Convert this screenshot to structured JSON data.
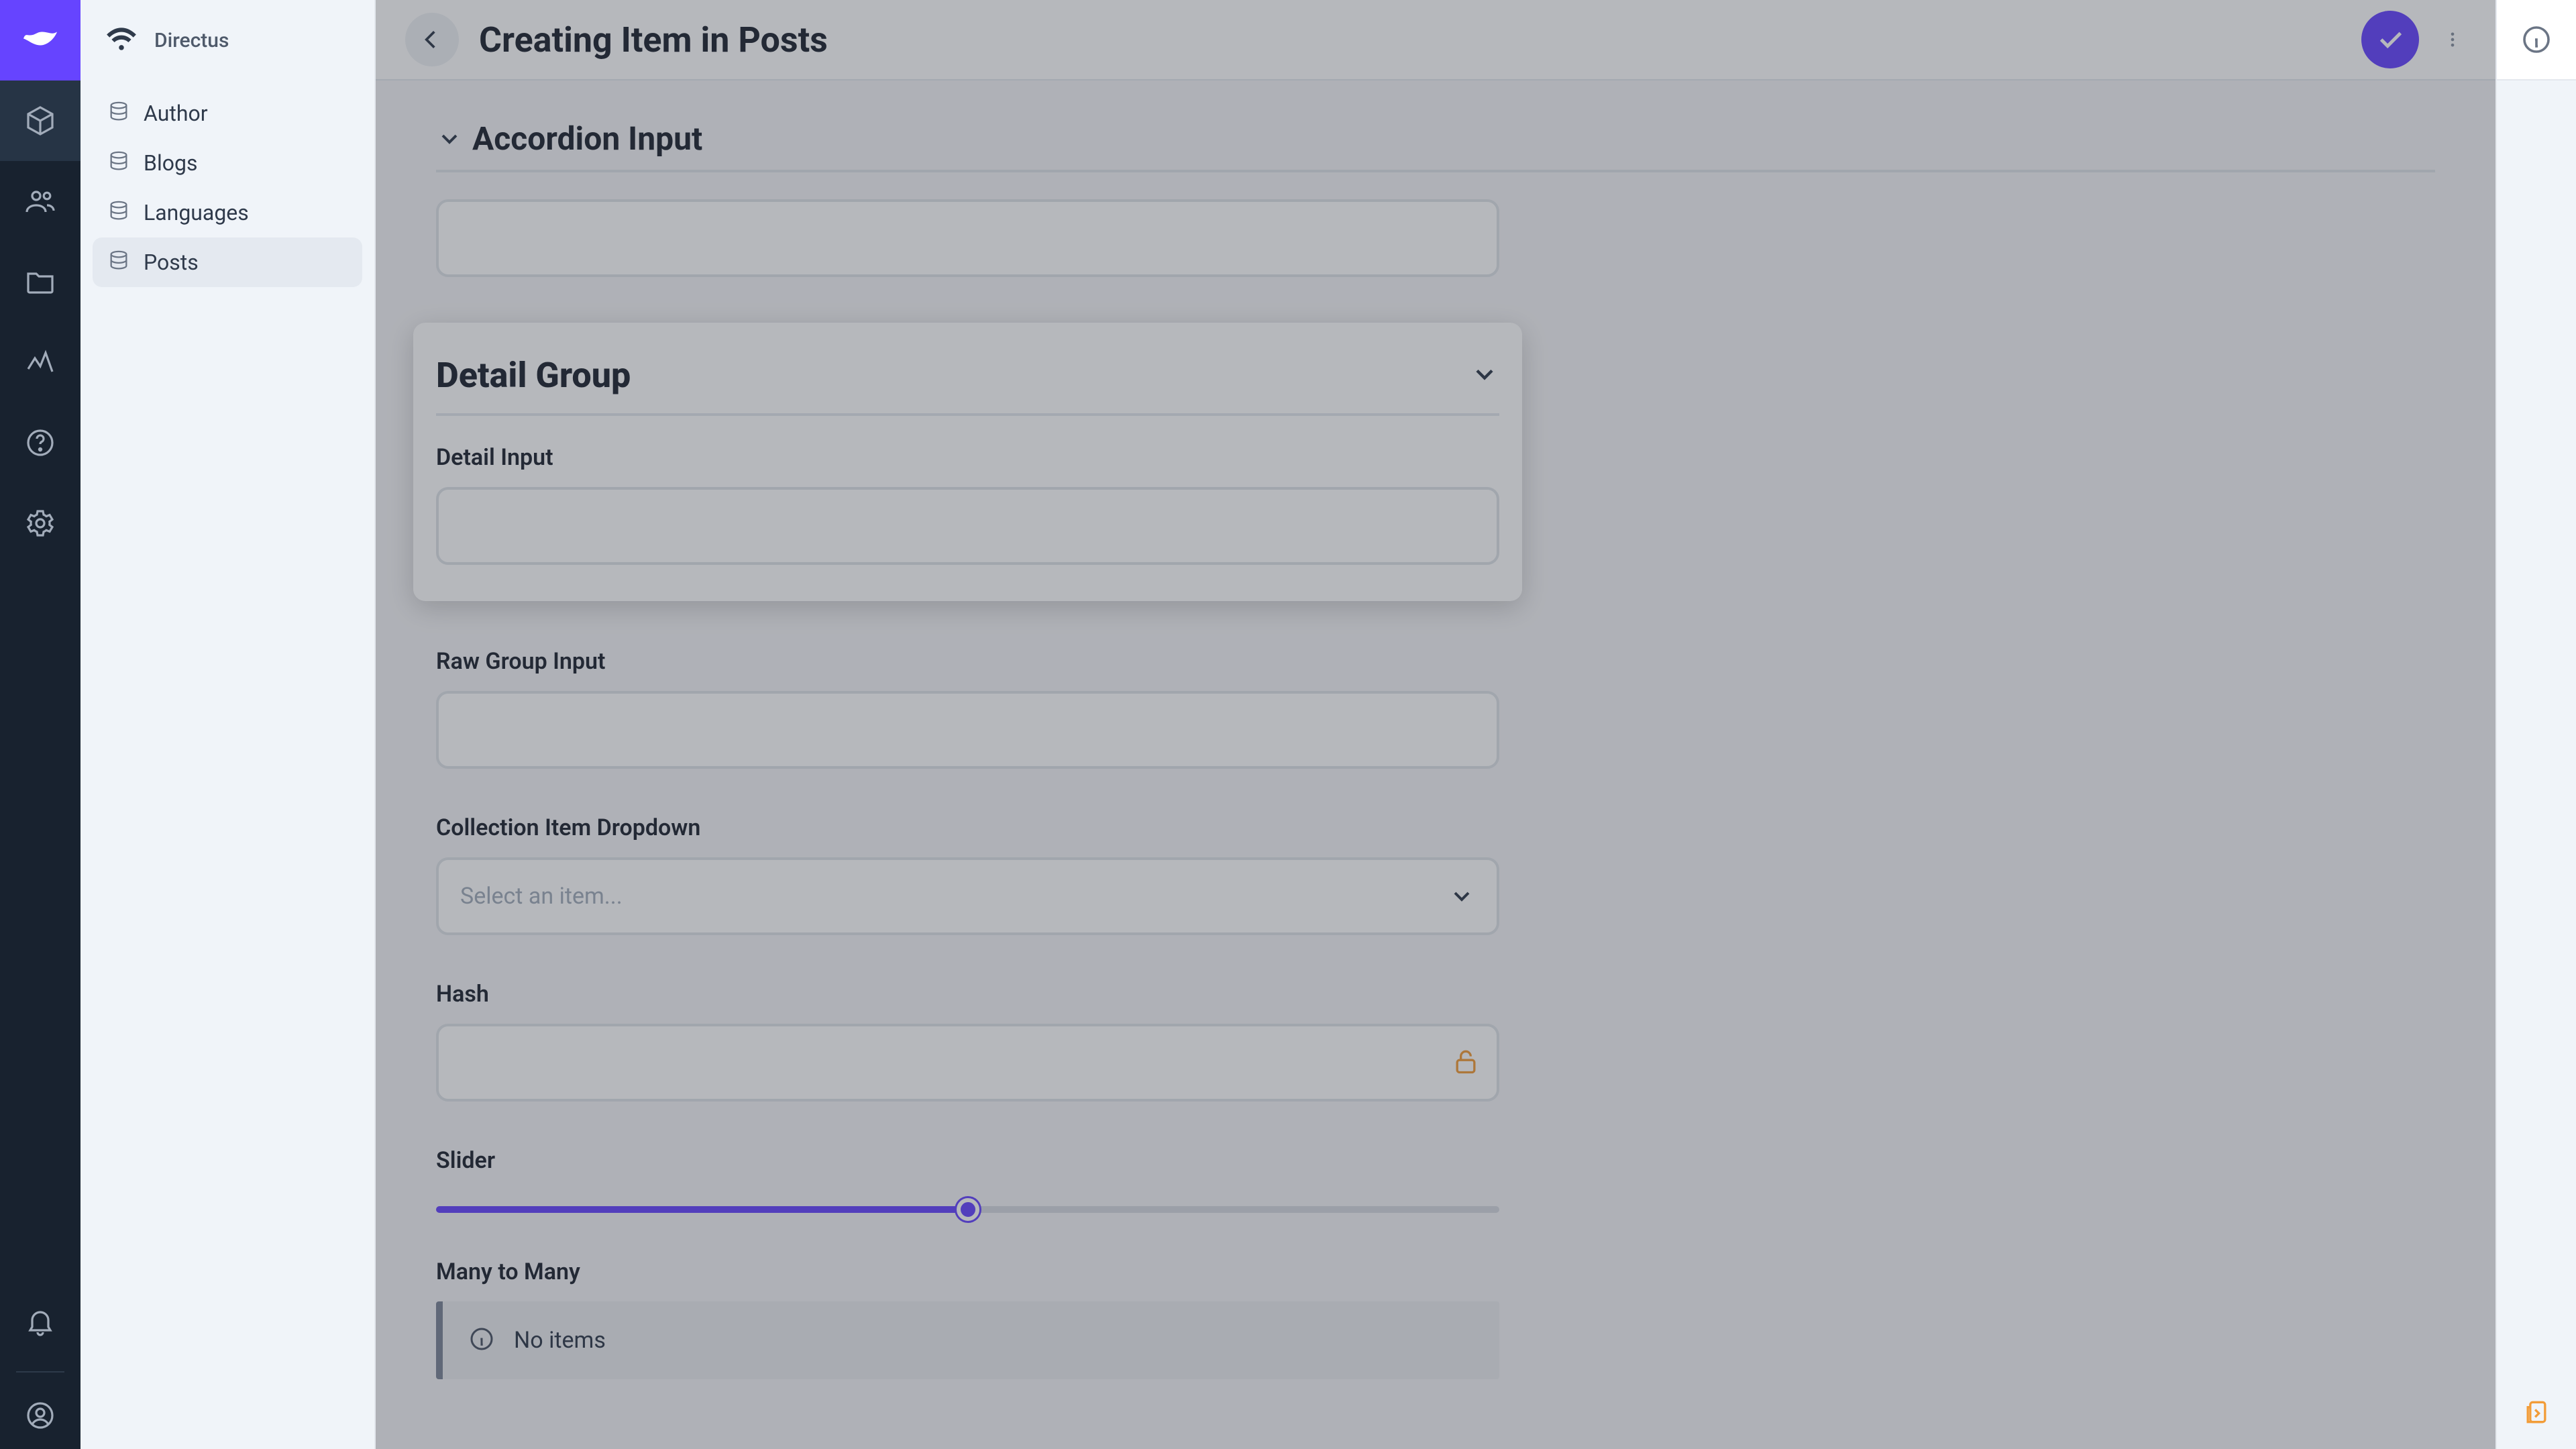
{
  "brand": "Directus",
  "page_title": "Creating Item in Posts",
  "nav": {
    "items": [
      {
        "label": "Author"
      },
      {
        "label": "Blogs"
      },
      {
        "label": "Languages"
      },
      {
        "label": "Posts"
      }
    ]
  },
  "form": {
    "accordion_title": "Accordion Input",
    "accordion_value": "",
    "detail_group_title": "Detail Group",
    "detail_input_label": "Detail Input",
    "detail_input_value": "",
    "raw_group_label": "Raw Group Input",
    "raw_group_value": "",
    "collection_label": "Collection Item Dropdown",
    "collection_placeholder": "Select an item...",
    "hash_label": "Hash",
    "hash_value": "",
    "slider_label": "Slider",
    "slider_value": 50,
    "m2m_label": "Many to Many",
    "m2m_empty": "No items"
  },
  "colors": {
    "accent": "#6644ff",
    "warn": "#f29c38"
  }
}
